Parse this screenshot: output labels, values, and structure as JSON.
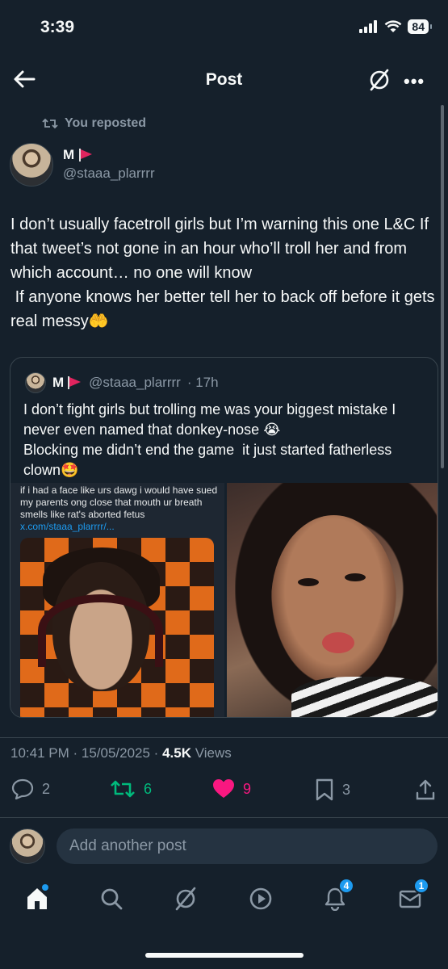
{
  "status_bar": {
    "time": "3:39",
    "battery": "84"
  },
  "header": {
    "title": "Post"
  },
  "post": {
    "repost_label": "You reposted",
    "author_name": "M",
    "author_handle": "@staaa_plarrrr",
    "text": "I don’t usually facetroll girls but I’m warning this one L&C If that tweet’s not gone in an hour who’ll troll her and from which account… no one will know\n If anyone knows her better tell her to back off before it gets real messy🤲",
    "quote": {
      "name": "M",
      "handle": "@staaa_plarrrr",
      "time": "· 17h",
      "text": "I don’t fight girls but trolling me was your biggest mistake I never even named that donkey-nose 😭\nBlocking me didn’t end the game  it just started fatherless clown🤩",
      "inner_tweet_text": "if i had a face like urs dawg i would have sued my parents ong close that mouth ur breath smells like rat's aborted fetus",
      "inner_link": "x.com/staaa_plarrrr/..."
    },
    "meta": {
      "time": "10:41 PM · 15/05/2025 · ",
      "views_count": "4.5K",
      "views_label": " Views"
    },
    "actions": {
      "replies": "2",
      "reposts": "6",
      "likes": "9",
      "bookmarks": "3"
    }
  },
  "reply": {
    "placeholder": "Add another post"
  },
  "tabbar": {
    "notifications_badge": "4",
    "messages_badge": "1"
  },
  "colors": {
    "background": "#15202b",
    "accent": "#1d9bf0",
    "repost_active": "#00ba7c",
    "like_active": "#f91880",
    "muted": "#8b98a5"
  }
}
